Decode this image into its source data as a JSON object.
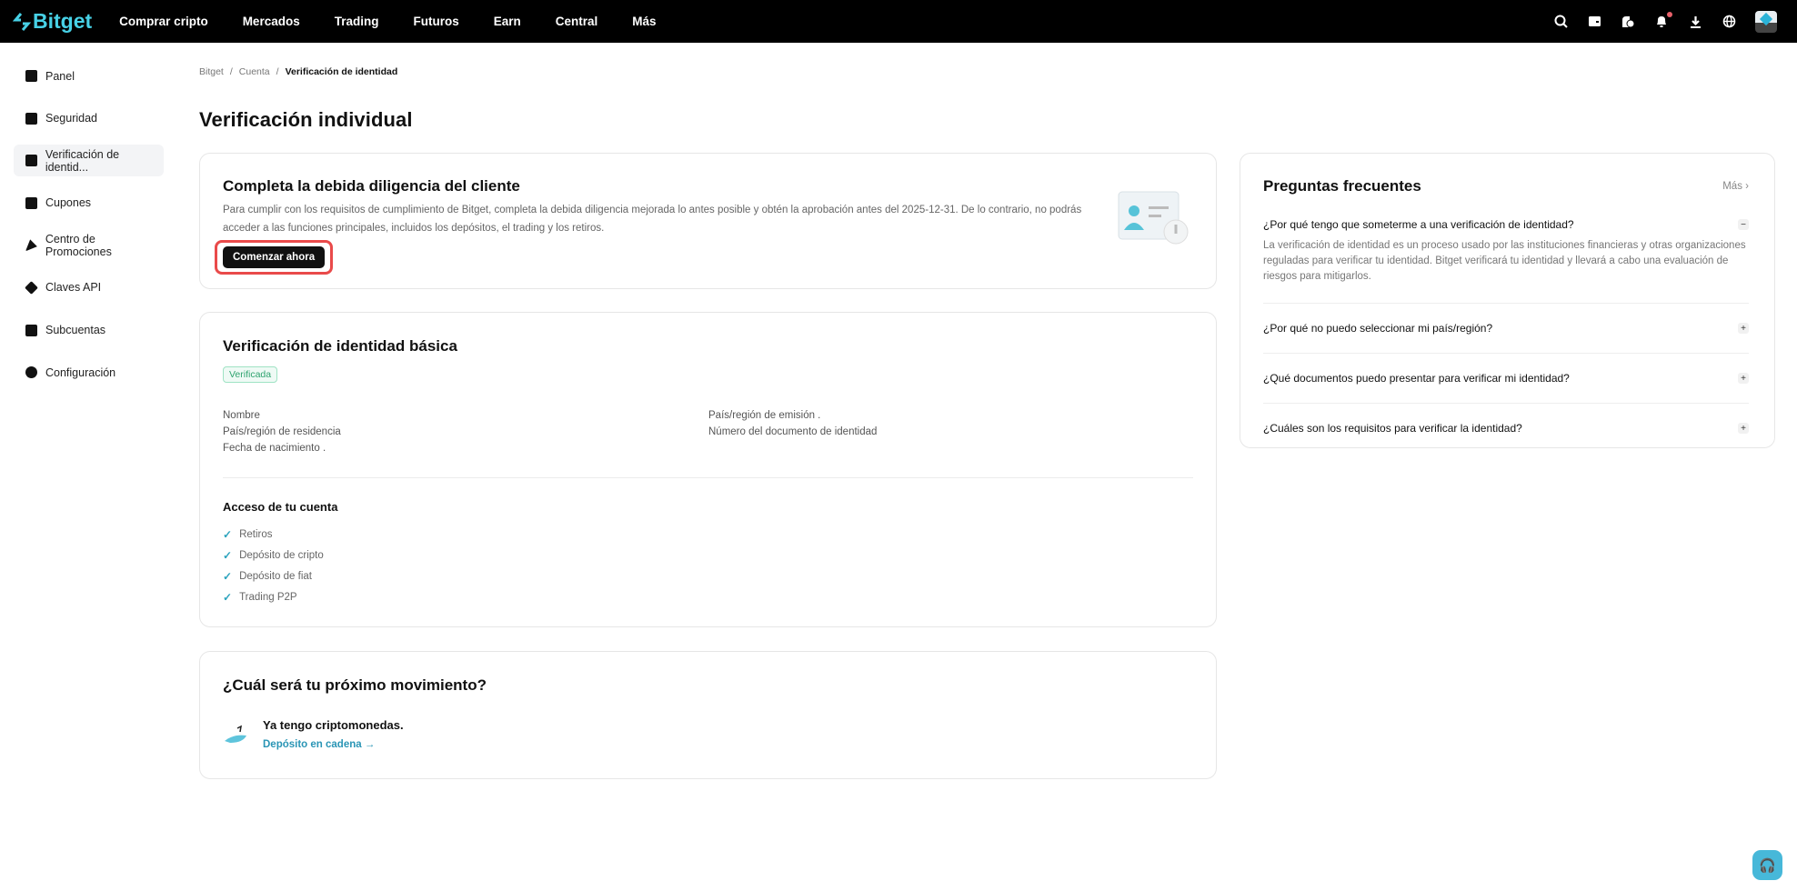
{
  "header": {
    "logo": "Bitget",
    "nav": [
      "Comprar cripto",
      "Mercados",
      "Trading",
      "Futuros",
      "Earn",
      "Central",
      "Más"
    ],
    "icons": [
      "search-icon",
      "wallet-icon",
      "orders-icon",
      "bell-icon",
      "download-icon",
      "globe-icon",
      "avatar"
    ]
  },
  "sidebar": {
    "items": [
      {
        "label": "Panel",
        "icon": "grid-icon"
      },
      {
        "label": "Seguridad",
        "icon": "bank-icon"
      },
      {
        "label": "Verificación de identid...",
        "icon": "id-card-icon"
      },
      {
        "label": "Cupones",
        "icon": "ticket-icon"
      },
      {
        "label": "Centro de Promociones",
        "icon": "party-icon"
      },
      {
        "label": "Claves API",
        "icon": "plug-icon"
      },
      {
        "label": "Subcuentas",
        "icon": "hierarchy-icon"
      },
      {
        "label": "Configuración",
        "icon": "gear-icon"
      }
    ],
    "active_index": 2
  },
  "breadcrumb": [
    "Bitget",
    "Cuenta",
    "Verificación de identidad"
  ],
  "page_title": "Verificación individual",
  "due_diligence": {
    "title": "Completa la debida diligencia del cliente",
    "description": "Para cumplir con los requisitos de cumplimiento de Bitget, completa la debida diligencia mejorada lo antes posible y obtén la aprobación antes del 2025-12-31. De lo contrario, no podrás acceder a las funciones principales, incluidos los depósitos, el trading y los retiros.",
    "button": "Comenzar ahora"
  },
  "basic": {
    "title": "Verificación de identidad básica",
    "status": "Verificada",
    "fields": [
      "Nombre",
      "País/región de emisión  .",
      "País/región de residencia",
      "Número del documento de identidad",
      "Fecha de nacimiento  ."
    ],
    "access_title": "Acceso de tu cuenta",
    "access": [
      "Retiros",
      "Depósito de cripto",
      "Depósito de fiat",
      "Trading P2P"
    ]
  },
  "next": {
    "title": "¿Cuál será tu próximo movimiento?",
    "option_title": "Ya tengo criptomonedas.",
    "option_link": "Depósito en cadena →"
  },
  "faq": {
    "title": "Preguntas frecuentes",
    "more": "Más",
    "items": [
      {
        "q": "¿Por qué tengo que someterme a una verificación de identidad?",
        "a": "La verificación de identidad es un proceso usado por las instituciones financieras y otras organizaciones reguladas para verificar tu identidad. Bitget verificará tu identidad y llevará a cabo una evaluación de riesgos para mitigarlos.",
        "open": true
      },
      {
        "q": "¿Por qué no puedo seleccionar mi país/región?"
      },
      {
        "q": "¿Qué documentos puedo presentar para verificar mi identidad?"
      },
      {
        "q": "¿Cuáles son los requisitos para verificar la identidad?"
      }
    ]
  },
  "colors": {
    "accent": "#47d1e6",
    "link": "#2a95b5",
    "highlight": "#e94a4a",
    "verified": "#2fa36f"
  }
}
